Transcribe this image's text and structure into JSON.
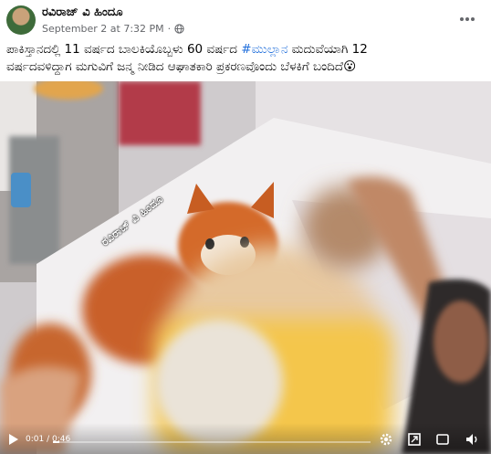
{
  "post": {
    "author": "ರವಿರಾಜ್ ವಿ ಹಿಂದೂ",
    "timestamp": "September 2 at 7:32 PM",
    "separator": "·",
    "privacy_icon": "globe-icon",
    "more_icon": "more-options-icon",
    "caption": {
      "line1_prefix": "ಪಾಕಿಸ್ತಾನದಲ್ಲಿ 11 ವರ್ಷದ ಬಾಲಕಿಯೊಬ್ಬಳು 60 ವರ್ಷದ ",
      "hashtag": "#ಮುಲ್ಲಾನ",
      "line1_suffix": " ಮದುವೆಯಾಗಿ 12",
      "line2": "ವರ್ಷದವಳಿದ್ದಾಗ ಮಗುವಿಗೆ ಜನ್ಮ ನೀಡಿದ ಆಘಾತಕಾರಿ ಪ್ರಕರಣವೊಂದು ಬೆಳಕಿಗೆ ಬಂದಿದೆ😮"
    }
  },
  "video": {
    "watermark": "ರವಿರಾಜ್ ವಿ ಹಿಂದೂ",
    "time": "0:01 / 0:46",
    "progress": 0.02,
    "controls": {
      "play_icon": "play-icon",
      "settings_icon": "settings-gear-icon",
      "volume_icon": "volume-icon",
      "expand_icon": "expand-icon",
      "fullscreen_icon": "fullscreen-icon"
    }
  }
}
